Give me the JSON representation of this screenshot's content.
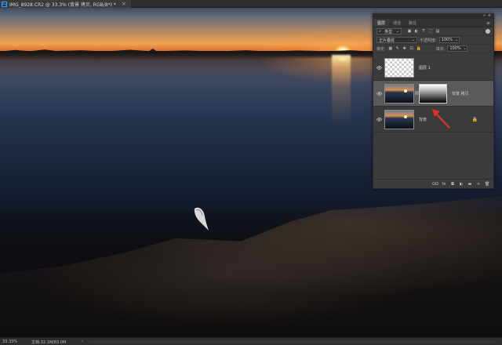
{
  "document": {
    "tab_title": "IMG_8928.CR2 @ 33.3% (背景 拷贝, RGB/8*) *",
    "tab_close": "×",
    "app_badge": "Ps"
  },
  "layers_panel": {
    "tabs": [
      {
        "label": "图层",
        "active": true
      },
      {
        "label": "通道",
        "active": false
      },
      {
        "label": "路径",
        "active": false
      }
    ],
    "collapse_glyph": "«",
    "close_glyph": "×",
    "menu_glyph": "≡",
    "filter_kind": "类型",
    "filter_icons": [
      "image-filter-icon",
      "adjustment-filter-icon",
      "type-filter-icon",
      "shape-filter-icon",
      "smart-object-filter-icon"
    ],
    "blend_mode": "正片叠底",
    "opacity_label": "不透明度:",
    "opacity_value": "100%",
    "lock_label": "锁定:",
    "fill_label": "填充:",
    "fill_value": "100%",
    "layers": [
      {
        "name": "图层 1",
        "type": "transparent",
        "visible": true,
        "selected": false,
        "locked": false
      },
      {
        "name": "背景 拷贝",
        "type": "photo-with-mask",
        "visible": true,
        "selected": true,
        "locked": false
      },
      {
        "name": "背景",
        "type": "photo",
        "visible": true,
        "selected": false,
        "locked": true
      }
    ],
    "bottom_icons": [
      "link-layers-icon",
      "fx-icon",
      "add-mask-icon",
      "adjustment-layer-icon",
      "group-icon",
      "new-layer-icon",
      "delete-icon"
    ],
    "bottom_glyphs": {
      "link": "GO",
      "fx": "fx",
      "mask": "◘",
      "adjust": "◐",
      "group": "▬",
      "new": "+",
      "delete": "🗑"
    }
  },
  "annotation": {
    "arrow_color": "#e0312c"
  },
  "status_bar": {
    "zoom": "33.33%",
    "doc_size": "文档:32.1M/83.0M",
    "more_glyph": "›"
  }
}
